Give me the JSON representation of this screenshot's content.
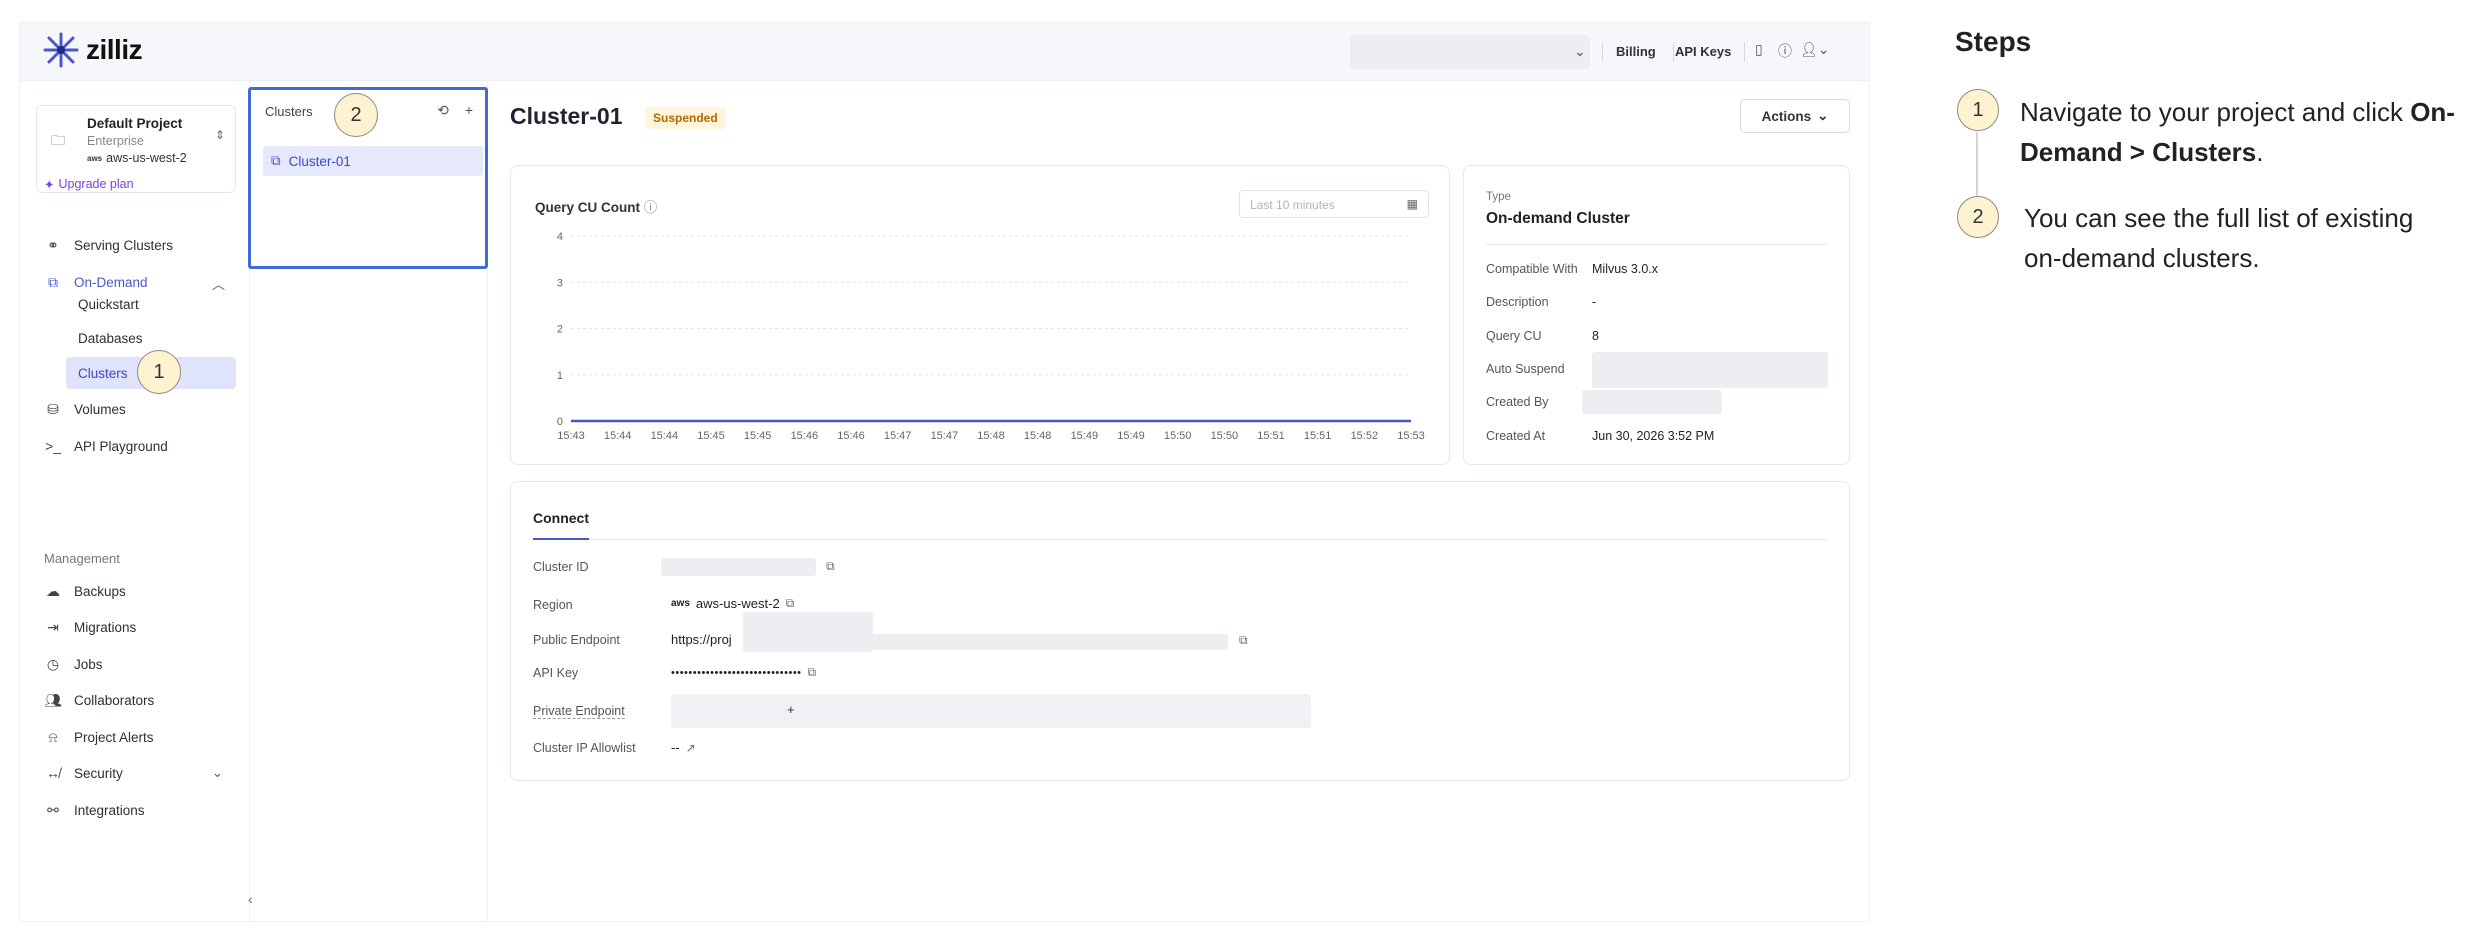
{
  "app": {
    "logo_text": "zilliz",
    "topbar": {
      "billing": "Billing",
      "api_keys": "API Keys"
    },
    "project": {
      "name": "Default Project",
      "plan": "Enterprise",
      "region": "aws-us-west-2",
      "region_provider": "aws",
      "upgrade": "Upgrade plan"
    },
    "nav": {
      "serving_clusters": "Serving Clusters",
      "on_demand": "On-Demand",
      "quickstart": "Quickstart",
      "databases": "Databases",
      "clusters": "Clusters",
      "volumes": "Volumes",
      "api_playground": "API Playground",
      "management_label": "Management",
      "backups": "Backups",
      "migrations": "Migrations",
      "jobs": "Jobs",
      "collaborators": "Collaborators",
      "project_alerts": "Project Alerts",
      "security": "Security",
      "integrations": "Integrations"
    },
    "cluster_list": {
      "title": "Clusters",
      "items": [
        "Cluster-01"
      ]
    },
    "cluster": {
      "name": "Cluster-01",
      "status": "Suspended",
      "actions": "Actions"
    },
    "chart_card": {
      "title": "Query CU Count",
      "time_placeholder": "Last 10 minutes"
    },
    "info": {
      "type_label": "Type",
      "type_value": "On-demand Cluster",
      "rows": [
        {
          "label": "Compatible With",
          "value": "Milvus 3.0.x"
        },
        {
          "label": "Description",
          "value": "-"
        },
        {
          "label": "Query CU",
          "value": "8"
        },
        {
          "label": "Auto Suspend",
          "value": ""
        },
        {
          "label": "Created By",
          "value": ""
        },
        {
          "label": "Created At",
          "value": "Jun 30, 2026 3:52 PM"
        }
      ]
    },
    "connect": {
      "tab": "Connect",
      "cluster_id_label": "Cluster ID",
      "region_label": "Region",
      "region_value": "aws-us-west-2",
      "public_endpoint_label": "Public Endpoint",
      "public_endpoint_value": "https://proj",
      "api_key_label": "API Key",
      "api_key_value": "••••••••••••••••••••••••••••••",
      "private_endpoint_label": "Private Endpoint",
      "private_endpoint_value": "+",
      "ip_allowlist_label": "Cluster IP Allowlist",
      "ip_allowlist_value": "--"
    }
  },
  "steps": {
    "title": "Steps",
    "items": [
      {
        "number": "1",
        "text_pre": "Navigate to your project and click ",
        "text_bold": "On-Demand > Clusters",
        "text_post": "."
      },
      {
        "number": "2",
        "text_pre": "You can see the full list of existing on-demand clusters.",
        "text_bold": "",
        "text_post": ""
      }
    ]
  },
  "annotations": [
    "1",
    "2"
  ],
  "chart_data": {
    "type": "line",
    "title": "Query CU Count",
    "x": [
      "15:43",
      "15:44",
      "15:44",
      "15:45",
      "15:45",
      "15:46",
      "15:46",
      "15:47",
      "15:47",
      "15:48",
      "15:48",
      "15:49",
      "15:49",
      "15:50",
      "15:50",
      "15:51",
      "15:51",
      "15:52",
      "15:53"
    ],
    "series": [
      {
        "values": [
          0,
          0,
          0,
          0,
          0,
          0,
          0,
          0,
          0,
          0,
          0,
          0,
          0,
          0,
          0,
          0,
          0,
          0,
          0
        ]
      }
    ],
    "y_ticks": [
      "0",
      "1",
      "2",
      "3",
      "4"
    ],
    "ylim": [
      0,
      4
    ],
    "grid": true,
    "line_color": "#4b57c9"
  }
}
